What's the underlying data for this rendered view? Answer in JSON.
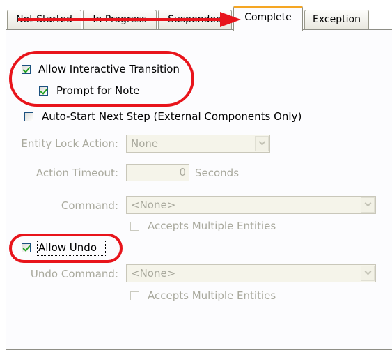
{
  "tabs": [
    {
      "label": "Not Started",
      "active": false
    },
    {
      "label": "In Progress",
      "active": false
    },
    {
      "label": "Suspended",
      "active": false
    },
    {
      "label": "Complete",
      "active": true
    },
    {
      "label": "Exception",
      "active": false
    }
  ],
  "options": {
    "allow_interactive_transition": {
      "label": "Allow Interactive Transition",
      "checked": true
    },
    "prompt_for_note": {
      "label": "Prompt for Note",
      "checked": true
    },
    "auto_start_next_step": {
      "label": "Auto-Start Next Step (External Components Only)",
      "checked": false
    },
    "allow_undo": {
      "label": "Allow Undo",
      "checked": true
    }
  },
  "entity_lock_action": {
    "label": "Entity Lock Action:",
    "value": "None"
  },
  "action_timeout": {
    "label": "Action Timeout:",
    "value": "0",
    "unit": "Seconds"
  },
  "command": {
    "label": "Command:",
    "value": "<None>",
    "accepts_multiple_label": "Accepts Multiple Entities",
    "accepts_multiple_checked": false
  },
  "undo_command": {
    "label": "Undo Command:",
    "value": "<None>",
    "accepts_multiple_label": "Accepts Multiple Entities",
    "accepts_multiple_checked": false
  },
  "annotation_color": "#e8141b",
  "active_tab_accent": "#f5a623",
  "check_color": "#21a121"
}
